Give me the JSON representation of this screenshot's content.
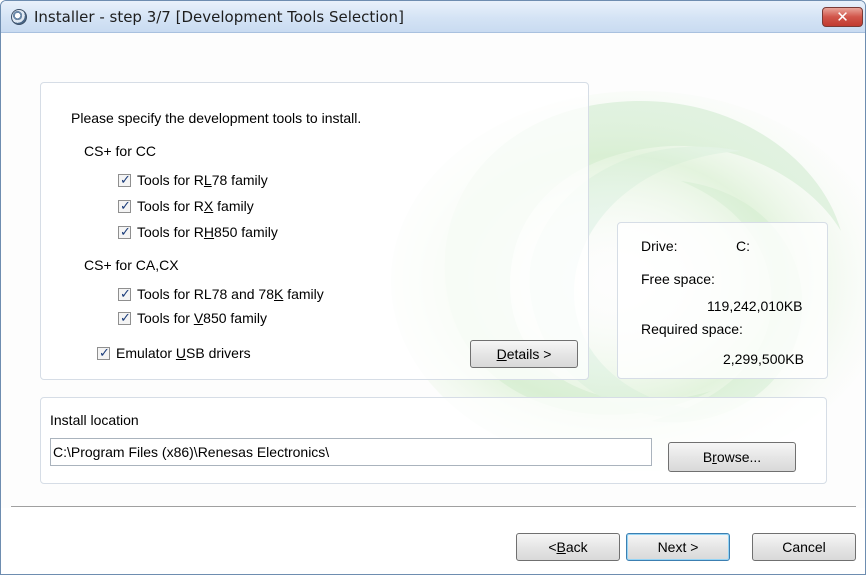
{
  "window": {
    "title": "Installer - step 3/7 [Development Tools Selection]",
    "close_label": "✕"
  },
  "tools": {
    "prompt": "Please specify the development tools to install.",
    "groups": [
      {
        "label": "CS+ for CC",
        "items": [
          {
            "pre": "Tools for R",
            "mnemonic": "L",
            "post": "78 family",
            "checked": true
          },
          {
            "pre": "Tools for R",
            "mnemonic": "X",
            "post": " family",
            "checked": true
          },
          {
            "pre": "Tools for R",
            "mnemonic": "H",
            "post": "850 family",
            "checked": true
          }
        ]
      },
      {
        "label": "CS+ for CA,CX",
        "items": [
          {
            "pre": "Tools for RL78 and 78",
            "mnemonic": "K",
            "post": " family",
            "checked": true
          },
          {
            "pre": "Tools for ",
            "mnemonic": "V",
            "post": "850 family",
            "checked": true
          }
        ]
      }
    ],
    "emulator": {
      "pre": "Emulator ",
      "mnemonic": "U",
      "post": "SB drivers",
      "checked": true
    },
    "details_button": {
      "mnemonic": "D",
      "post": "etails >"
    }
  },
  "space": {
    "drive_label": "Drive:",
    "drive_value": "C:",
    "free_label": "Free space:",
    "free_value": "119,242,010KB",
    "required_label": "Required space:",
    "required_value": "2,299,500KB"
  },
  "location": {
    "label": "Install location",
    "path": "C:\\Program Files (x86)\\Renesas Electronics\\",
    "browse_button": {
      "pre": "B",
      "mnemonic": "r",
      "post": "owse..."
    }
  },
  "nav": {
    "back": {
      "pre": "< ",
      "mnemonic": "B",
      "post": "ack"
    },
    "next_label": "Next >",
    "cancel_label": "Cancel"
  },
  "colors": {
    "title_gradient_top": "#e9f1fb",
    "close_red": "#c13b30",
    "default_button_border": "#3c7fb1",
    "swirl_green": "#c9e7c0"
  }
}
